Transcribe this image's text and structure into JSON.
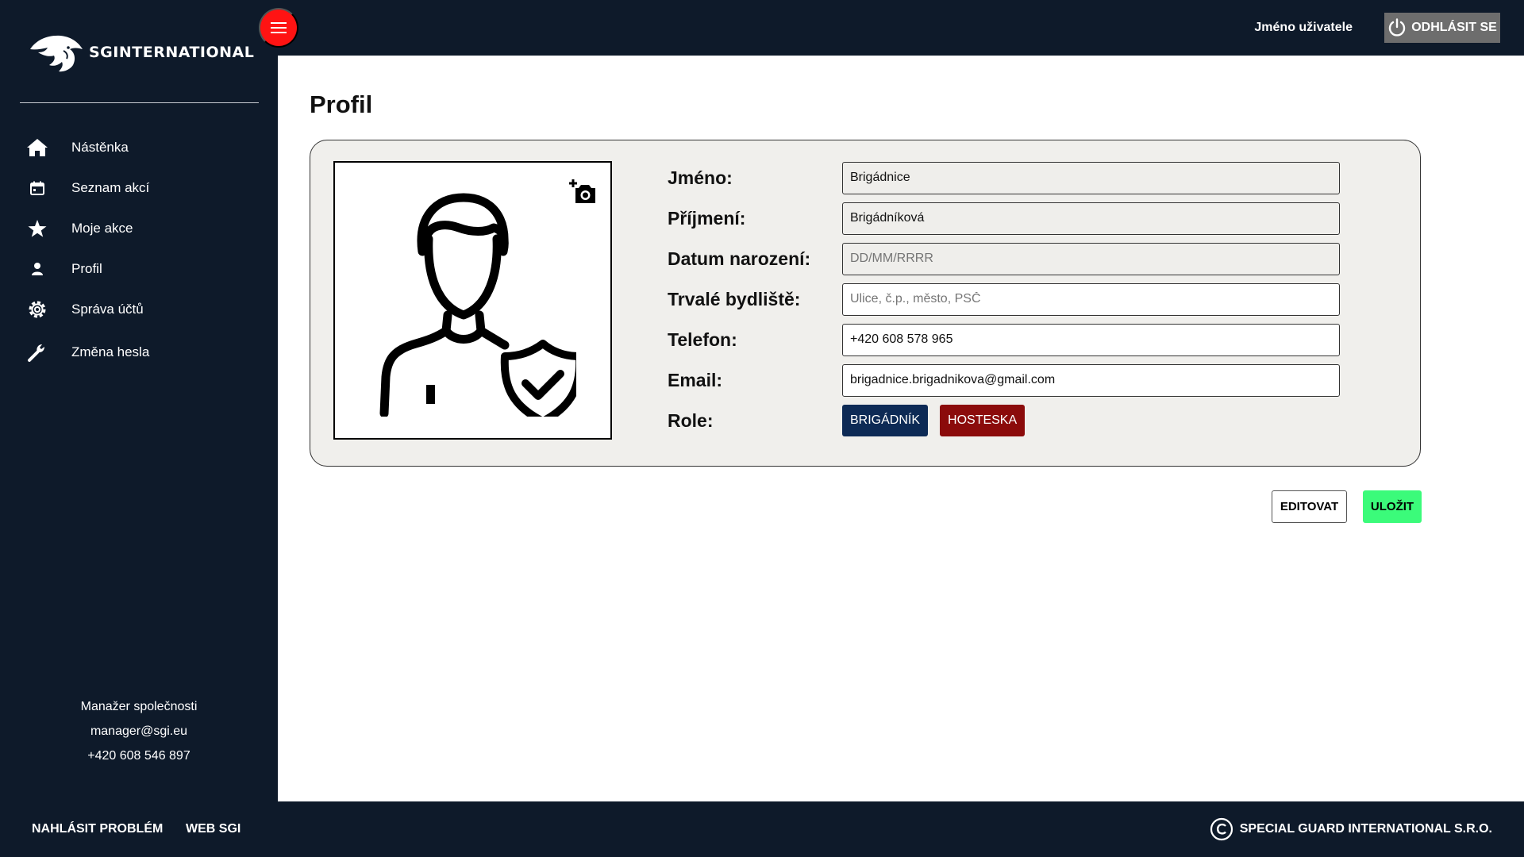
{
  "brand": {
    "name": "SGINTERNATIONAL"
  },
  "header": {
    "username": "Jméno uživatele",
    "logout_label": "ODHLÁSIT SE"
  },
  "sidebar": {
    "items": [
      {
        "label": "Nástěnka",
        "icon": "home-icon"
      },
      {
        "label": "Seznam akcí",
        "icon": "calendar-icon"
      },
      {
        "label": "Moje akce",
        "icon": "star-icon"
      },
      {
        "label": "Profil",
        "icon": "user-icon"
      },
      {
        "label": "Správa účtů",
        "icon": "gear-icon"
      },
      {
        "label": "Změna hesla",
        "icon": "wrench-icon"
      }
    ],
    "contact": {
      "role": "Manažer společnosti",
      "email": "manager@sgi.eu",
      "phone": "+420 608 546 897"
    }
  },
  "main": {
    "title": "Profil",
    "form": {
      "first_name": {
        "label": "Jméno:",
        "value": "Brigádnice"
      },
      "last_name": {
        "label": "Příjmení:",
        "value": "Brigádníková"
      },
      "birth_date": {
        "label": "Datum narození:",
        "value": "",
        "placeholder": "DD/MM/RRRR"
      },
      "address": {
        "label": "Trvalé bydliště:",
        "value": "",
        "placeholder": "Ulice, č.p., město, PSČ"
      },
      "phone": {
        "label": "Telefon:",
        "value": "+420 608 578 965"
      },
      "email": {
        "label": "Email:",
        "value": "brigadnice.brigadnikova@gmail.com"
      },
      "roles": {
        "label": "Role:",
        "items": [
          "BRIGÁDNÍK",
          "HOSTESKA"
        ]
      }
    },
    "edit_label": "EDITOVAT",
    "save_label": "ULOŽIT"
  },
  "footer": {
    "report_label": "NAHLÁSIT PROBLÉM",
    "web_label": "WEB SGI",
    "copyright": "SPECIAL GUARD INTERNATIONAL S.R.O."
  },
  "colors": {
    "background": "#0e1a2a",
    "menu_toggle": "#ff1313",
    "role_brigadnik": "#0d2a55",
    "role_hosteska": "#8b0b0b",
    "save": "#3bfb7a",
    "logout": "#6d6d6d"
  }
}
